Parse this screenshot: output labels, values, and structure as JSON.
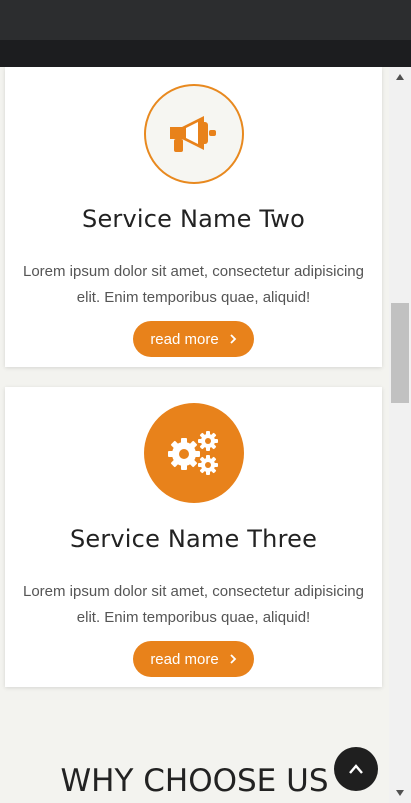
{
  "services": [
    {
      "title": "Service Name Two",
      "description": "Lorem ipsum dolor sit amet, consectetur adipisicing elit. Enim temporibus quae, aliquid!",
      "button_label": "read more",
      "icon": "megaphone-icon"
    },
    {
      "title": "Service Name Three",
      "description": "Lorem ipsum dolor sit amet, consectetur adipisicing elit. Enim temporibus quae, aliquid!",
      "button_label": "read more",
      "icon": "gears-icon"
    }
  ],
  "section": {
    "heading": "WHY CHOOSE US"
  },
  "colors": {
    "accent": "#e8821b",
    "dark_bar": "#2c2d2f",
    "background": "#f3f3ef"
  }
}
